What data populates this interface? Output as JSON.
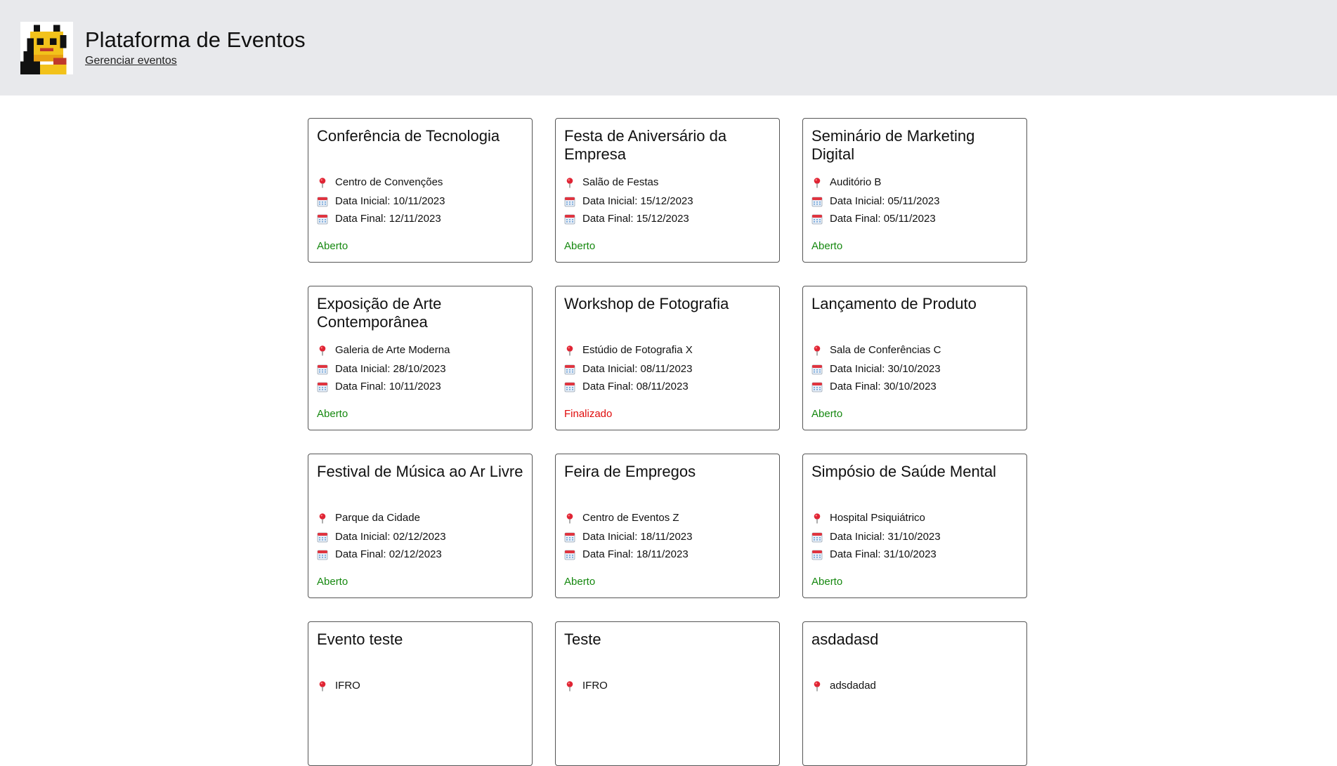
{
  "header": {
    "logo_icon": "pixel-cat-logo",
    "title": "Plataforma de Eventos",
    "manage_link": "Gerenciar eventos"
  },
  "events": [
    {
      "title": "Conferência de Tecnologia",
      "location": "Centro de Convenções",
      "start": "Data Inicial: 10/11/2023",
      "end": "Data Final: 12/11/2023",
      "status": "Aberto",
      "status_color": "#15880f"
    },
    {
      "title": "Festa de Aniversário da Empresa",
      "location": "Salão de Festas",
      "start": "Data Inicial: 15/12/2023",
      "end": "Data Final: 15/12/2023",
      "status": "Aberto",
      "status_color": "#15880f"
    },
    {
      "title": "Seminário de Marketing Digital",
      "location": "Auditório B",
      "start": "Data Inicial: 05/11/2023",
      "end": "Data Final: 05/11/2023",
      "status": "Aberto",
      "status_color": "#15880f"
    },
    {
      "title": "Exposição de Arte Contemporânea",
      "location": "Galeria de Arte Moderna",
      "start": "Data Inicial: 28/10/2023",
      "end": "Data Final: 10/11/2023",
      "status": "Aberto",
      "status_color": "#15880f"
    },
    {
      "title": "Workshop de Fotografia",
      "location": "Estúdio de Fotografia X",
      "start": "Data Inicial: 08/11/2023",
      "end": "Data Final: 08/11/2023",
      "status": "Finalizado",
      "status_color": "#e00b0b"
    },
    {
      "title": "Lançamento de Produto",
      "location": "Sala de Conferências C",
      "start": "Data Inicial: 30/10/2023",
      "end": "Data Final: 30/10/2023",
      "status": "Aberto",
      "status_color": "#15880f"
    },
    {
      "title": "Festival de Música ao Ar Livre",
      "location": "Parque da Cidade",
      "start": "Data Inicial: 02/12/2023",
      "end": "Data Final: 02/12/2023",
      "status": "Aberto",
      "status_color": "#15880f"
    },
    {
      "title": "Feira de Empregos",
      "location": "Centro de Eventos Z",
      "start": "Data Inicial: 18/11/2023",
      "end": "Data Final: 18/11/2023",
      "status": "Aberto",
      "status_color": "#15880f"
    },
    {
      "title": "Simpósio de Saúde Mental",
      "location": "Hospital Psiquiátrico",
      "start": "Data Inicial: 31/10/2023",
      "end": "Data Final: 31/10/2023",
      "status": "Aberto",
      "status_color": "#15880f"
    },
    {
      "title": "Evento teste",
      "location": "IFRO"
    },
    {
      "title": "Teste",
      "location": "IFRO"
    },
    {
      "title": "asdadasd",
      "location": "adsdadad"
    }
  ],
  "icons": {
    "location": "pin-icon",
    "date": "calendar-icon"
  }
}
